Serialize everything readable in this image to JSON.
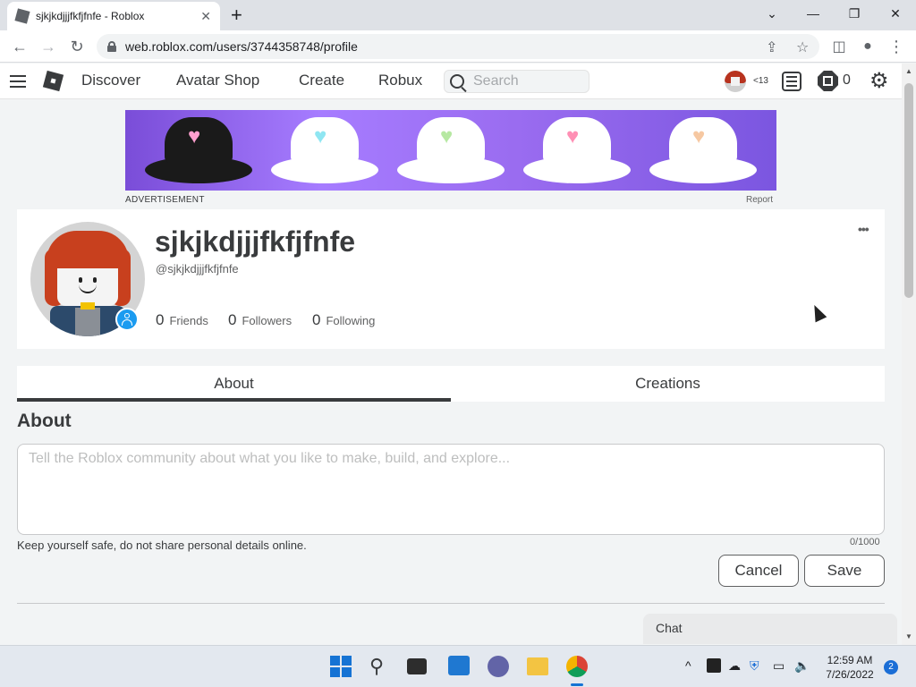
{
  "browser": {
    "tab_title": "sjkjkdjjjfkfjfnfe - Roblox",
    "tab_close": "✕",
    "new_tab": "+",
    "url": "web.roblox.com/users/3744358748/profile",
    "window_controls": {
      "collapse": "⌄",
      "minimize": "—",
      "restore": "❐",
      "close": "✕"
    }
  },
  "roblox_header": {
    "nav": [
      "Discover",
      "Avatar Shop",
      "Create",
      "Robux"
    ],
    "search_placeholder": "Search",
    "age_tag": "<13",
    "robux_balance": "0"
  },
  "ad": {
    "label": "ADVERTISEMENT",
    "report": "Report",
    "hats": [
      {
        "hat_color": "#1a1a1a",
        "heart_color": "#ff9fcf"
      },
      {
        "hat_color": "#ffffff",
        "heart_color": "#8fe6f2"
      },
      {
        "hat_color": "#ffffff",
        "heart_color": "#b6e8a2"
      },
      {
        "hat_color": "#ffffff",
        "heart_color": "#ff8fb4"
      },
      {
        "hat_color": "#ffffff",
        "heart_color": "#f6c8a2"
      }
    ]
  },
  "profile": {
    "display_name": "sjkjkdjjjfkfjfnfe",
    "username": "@sjkjkdjjjfkfjfnfe",
    "more": "•••",
    "stats": [
      {
        "count": "0",
        "label": "Friends"
      },
      {
        "count": "0",
        "label": "Followers"
      },
      {
        "count": "0",
        "label": "Following"
      }
    ]
  },
  "tabs": [
    "About",
    "Creations"
  ],
  "about": {
    "heading": "About",
    "value": "",
    "placeholder": "Tell the Roblox community about what you like to make, build, and explore...",
    "safety_note": "Keep yourself safe, do not share personal details online.",
    "char_count": "0/1000",
    "cancel_label": "Cancel",
    "save_label": "Save"
  },
  "chat": {
    "label": "Chat"
  },
  "taskbar": {
    "time": "12:59 AM",
    "date": "7/26/2022",
    "notification_count": "2"
  }
}
